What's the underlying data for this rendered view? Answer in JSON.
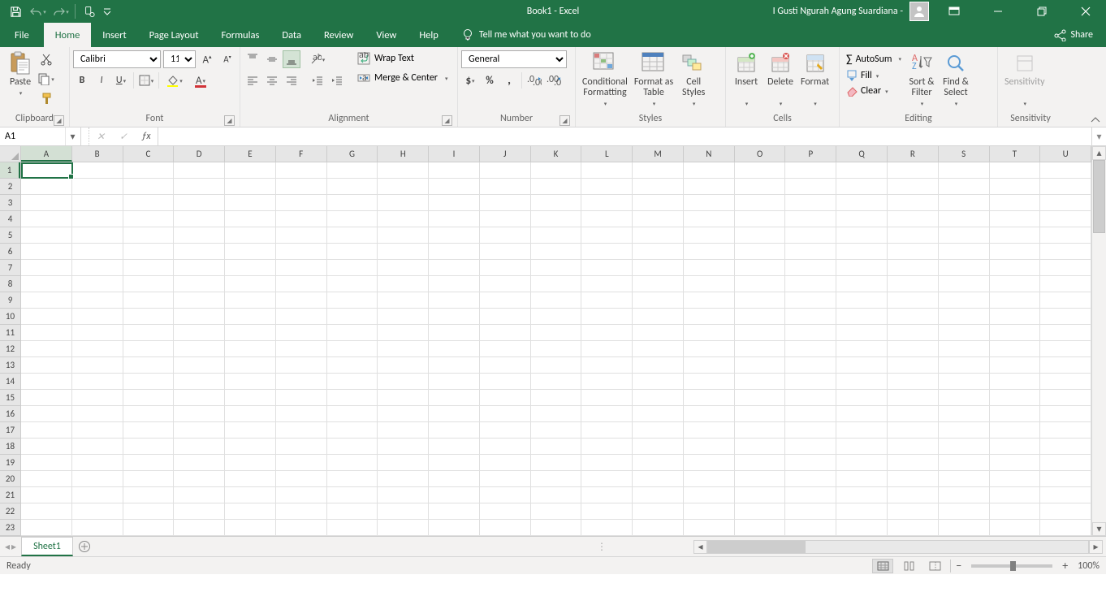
{
  "title": "Book1  -  Excel",
  "user": "I Gusti Ngurah Agung Suardiana -",
  "tabs": {
    "file": "File",
    "home": "Home",
    "insert": "Insert",
    "pageLayout": "Page Layout",
    "formulas": "Formulas",
    "data": "Data",
    "review": "Review",
    "view": "View",
    "help": "Help",
    "tellMe": "Tell me what you want to do"
  },
  "share": "Share",
  "groups": {
    "clipboard": {
      "label": "Clipboard",
      "paste": "Paste"
    },
    "font": {
      "label": "Font",
      "name": "Calibri",
      "size": "11"
    },
    "alignment": {
      "label": "Alignment",
      "wrap": "Wrap Text",
      "merge": "Merge & Center"
    },
    "number": {
      "label": "Number",
      "format": "General"
    },
    "styles": {
      "label": "Styles",
      "cond": "Conditional\nFormatting",
      "fmtTable": "Format as\nTable",
      "cellStyles": "Cell\nStyles"
    },
    "cells": {
      "label": "Cells",
      "insert": "Insert",
      "delete": "Delete",
      "format": "Format"
    },
    "editing": {
      "label": "Editing",
      "autosum": "AutoSum",
      "fill": "Fill",
      "clear": "Clear",
      "sort": "Sort &\nFilter",
      "find": "Find &\nSelect"
    },
    "sensitivity": {
      "label": "Sensitivity",
      "btn": "Sensitivity"
    }
  },
  "nameBox": "A1",
  "columns": [
    "A",
    "B",
    "C",
    "D",
    "E",
    "F",
    "G",
    "H",
    "I",
    "J",
    "K",
    "L",
    "M",
    "N",
    "O",
    "P",
    "Q",
    "R",
    "S",
    "T",
    "U"
  ],
  "rowCount": 23,
  "sheetTab": "Sheet1",
  "status": "Ready",
  "zoom": "100%"
}
